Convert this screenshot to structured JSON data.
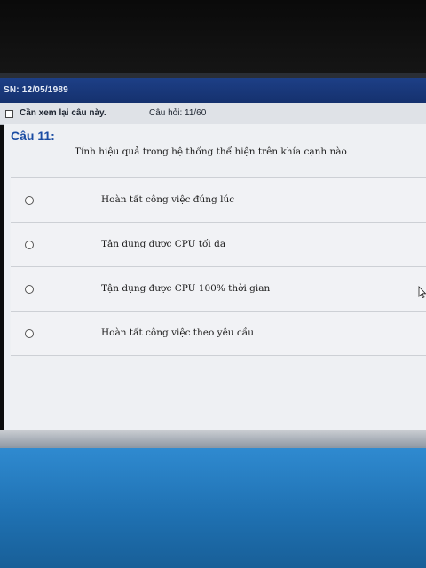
{
  "header": {
    "student_info": "SN: 12/05/1989"
  },
  "toolbar": {
    "review_label": "Cần xem lại câu này.",
    "question_counter": "Câu hỏi: 11/60"
  },
  "question": {
    "title": "Câu 11:",
    "text": "Tính hiệu quả trong hệ thống thể hiện trên khía cạnh nào",
    "answers": [
      "Hoàn tất công việc đúng lúc",
      "Tận dụng được CPU tối đa",
      "Tận dụng được CPU 100% thời gian",
      "Hoàn tất công việc theo yêu cầu"
    ]
  },
  "colors": {
    "accent": "#1a4ca3",
    "header_bar": "#1d3f86"
  }
}
